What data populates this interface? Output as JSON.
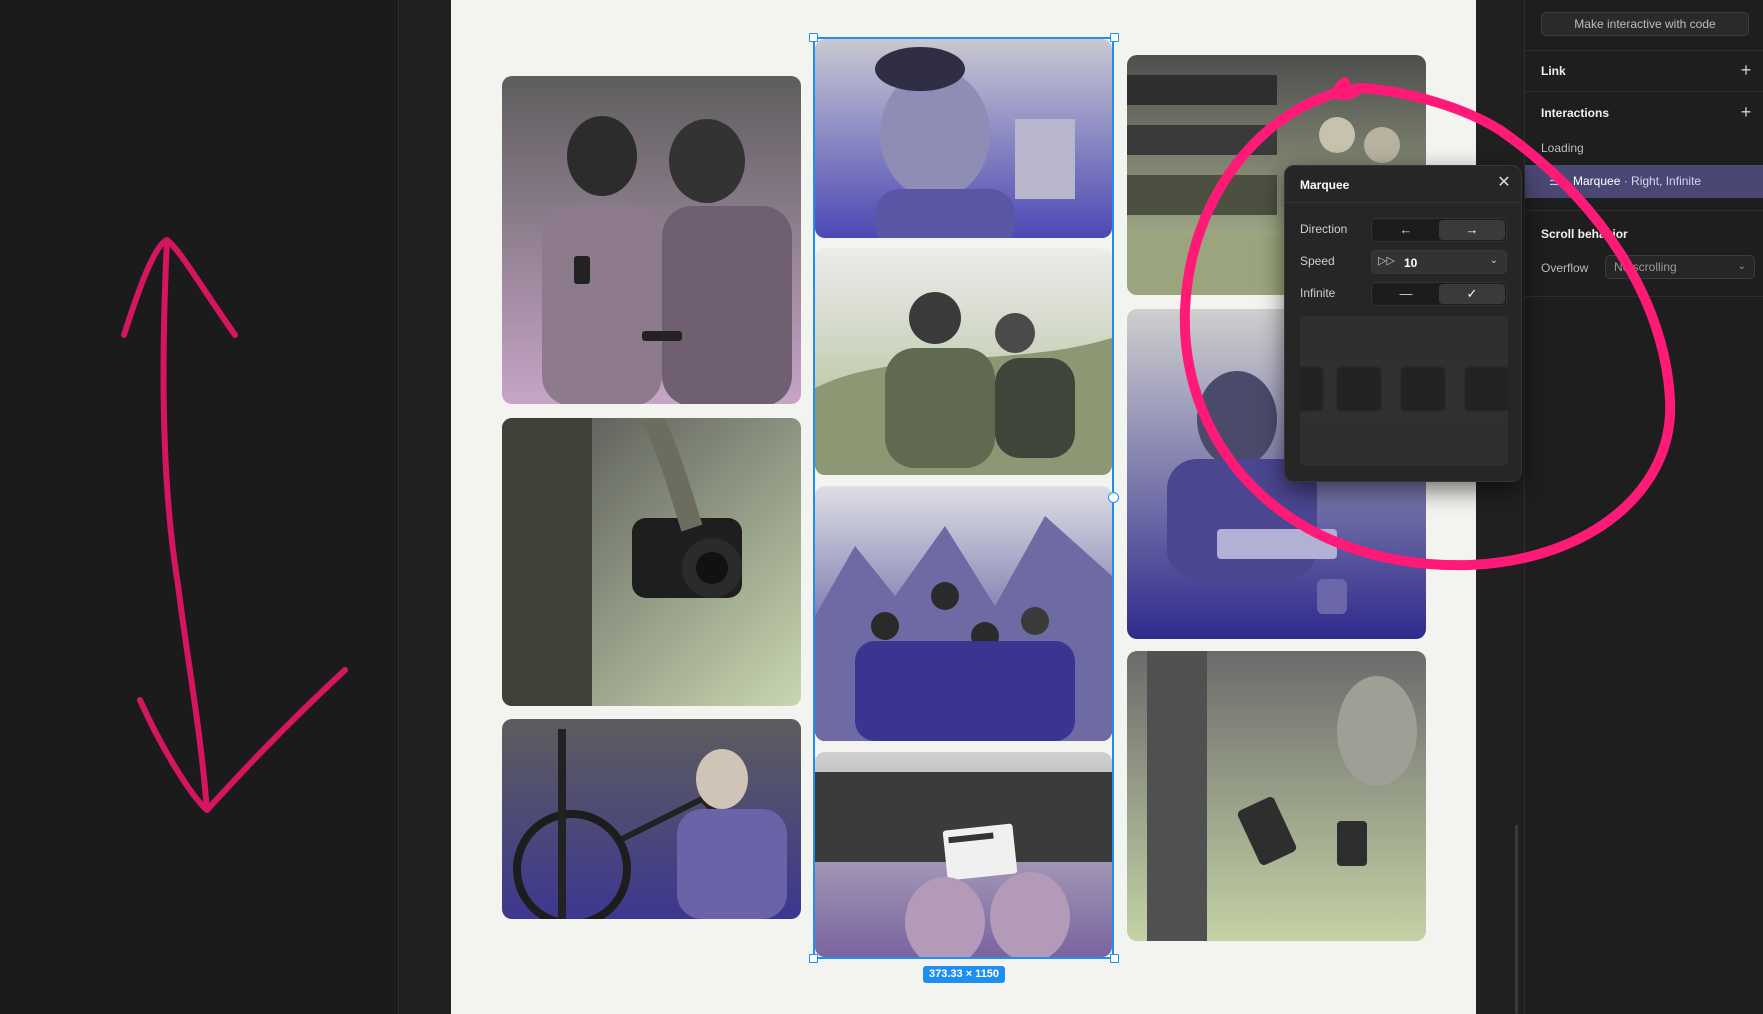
{
  "canvas": {
    "selection_size": "373.33 × 1150"
  },
  "right_panel": {
    "make_interactive_label": "Make interactive with code",
    "link_title": "Link",
    "interactions_title": "Interactions",
    "loading_label": "Loading",
    "interaction_item": {
      "name": "Marquee",
      "detail": " · Right, Infinite"
    },
    "scroll_title": "Scroll behavior",
    "overflow_label": "Overflow",
    "overflow_value": "No scrolling"
  },
  "marquee_popover": {
    "title": "Marquee",
    "direction_label": "Direction",
    "speed_label": "Speed",
    "speed_value": "10",
    "infinite_label": "Infinite",
    "direction_options": [
      "←",
      "→"
    ],
    "direction_selected": "right",
    "infinite_options": [
      "—",
      "✓"
    ],
    "infinite_selected": "on"
  },
  "icons": {
    "close": "close-icon",
    "plus": "plus-icon",
    "speed": "fast-forward-icon",
    "chevron": "chevron-down-icon",
    "marquee": "marquee-icon"
  },
  "colors": {
    "accent": "#1e8ff0",
    "annotation": "#ff1a78",
    "highlight_row": "#4a4774"
  }
}
